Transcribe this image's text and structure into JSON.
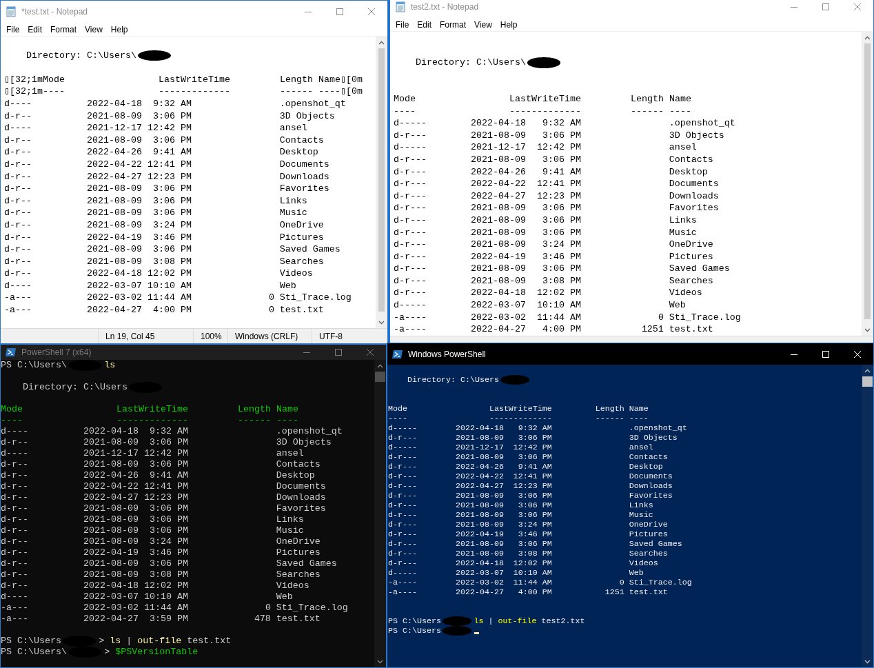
{
  "windows": [
    {
      "kind": "notepad",
      "title": "*test.txt - Notepad",
      "active": false,
      "menu": [
        "File",
        "Edit",
        "Format",
        "View",
        "Help"
      ],
      "lines": [
        {
          "kind": "blank"
        },
        {
          "kind": "directory",
          "parts": [
            {
              "kind": "plain",
              "text": "Directory: C:\\Users\\"
            },
            {
              "kind": "redacted"
            }
          ]
        },
        {
          "kind": "blank"
        },
        {
          "kind": "header",
          "cells": [
            "▯[32;1mMode",
            "LastWriteTime",
            "Length",
            "Name▯[0m"
          ]
        },
        {
          "kind": "underline",
          "cells": [
            "▯[32;1m----",
            "-------------",
            "------",
            "----▯[0m"
          ]
        },
        {
          "kind": "row",
          "mode": "d----",
          "date": "2022-04-18",
          "time": "9:32 AM",
          "name": ".openshot_qt"
        },
        {
          "kind": "row",
          "mode": "d-r--",
          "date": "2021-08-09",
          "time": "3:06 PM",
          "name": "3D Objects"
        },
        {
          "kind": "row",
          "mode": "d----",
          "date": "2021-12-17",
          "time": "12:42 PM",
          "name": "ansel"
        },
        {
          "kind": "row",
          "mode": "d-r--",
          "date": "2021-08-09",
          "time": "3:06 PM",
          "name": "Contacts"
        },
        {
          "kind": "row",
          "mode": "d-r--",
          "date": "2022-04-26",
          "time": "9:41 AM",
          "name": "Desktop"
        },
        {
          "kind": "row",
          "mode": "d-r--",
          "date": "2022-04-22",
          "time": "12:41 PM",
          "name": "Documents"
        },
        {
          "kind": "row",
          "mode": "d-r--",
          "date": "2022-04-27",
          "time": "12:23 PM",
          "name": "Downloads"
        },
        {
          "kind": "row",
          "mode": "d-r--",
          "date": "2021-08-09",
          "time": "3:06 PM",
          "name": "Favorites"
        },
        {
          "kind": "row",
          "mode": "d-r--",
          "date": "2021-08-09",
          "time": "3:06 PM",
          "name": "Links"
        },
        {
          "kind": "row",
          "mode": "d-r--",
          "date": "2021-08-09",
          "time": "3:06 PM",
          "name": "Music"
        },
        {
          "kind": "row",
          "mode": "d-r--",
          "date": "2021-08-09",
          "time": "3:24 PM",
          "name": "OneDrive"
        },
        {
          "kind": "row",
          "mode": "d-r--",
          "date": "2022-04-19",
          "time": "3:46 PM",
          "name": "Pictures"
        },
        {
          "kind": "row",
          "mode": "d-r--",
          "date": "2021-08-09",
          "time": "3:06 PM",
          "name": "Saved Games"
        },
        {
          "kind": "row",
          "mode": "d-r--",
          "date": "2021-08-09",
          "time": "3:08 PM",
          "name": "Searches"
        },
        {
          "kind": "row",
          "mode": "d-r--",
          "date": "2022-04-18",
          "time": "12:02 PM",
          "name": "Videos"
        },
        {
          "kind": "row",
          "mode": "d----",
          "date": "2022-03-07",
          "time": "10:10 AM",
          "name": "Web"
        },
        {
          "kind": "row",
          "mode": "-a---",
          "date": "2022-03-02",
          "time": "11:44 AM",
          "length": "0",
          "name": "Sti_Trace.log"
        },
        {
          "kind": "row",
          "mode": "-a---",
          "date": "2022-04-27",
          "time": "4:00 PM",
          "length": "0",
          "name": "test.txt"
        }
      ],
      "status": [
        "Ln 19, Col 45",
        "100%",
        "Windows (CRLF)",
        "UTF-8"
      ]
    },
    {
      "kind": "notepad",
      "title": "test2.txt - Notepad",
      "active": false,
      "menu": [
        "File",
        "Edit",
        "Format",
        "View",
        "Help"
      ],
      "lines": [
        {
          "kind": "blank"
        },
        {
          "kind": "blank"
        },
        {
          "kind": "directory",
          "parts": [
            {
              "kind": "plain",
              "text": "Directory: C:\\Users\\"
            },
            {
              "kind": "redacted"
            }
          ]
        },
        {
          "kind": "blank"
        },
        {
          "kind": "blank"
        },
        {
          "kind": "header",
          "cells": [
            "Mode",
            "LastWriteTime",
            "Length",
            "Name"
          ]
        },
        {
          "kind": "underline",
          "cells": [
            "----",
            "-------------",
            "------",
            "----"
          ]
        },
        {
          "kind": "row",
          "mode": "d-----",
          "date": "2022-04-18",
          "time": "9:32 AM",
          "name": ".openshot_qt"
        },
        {
          "kind": "row",
          "mode": "d-r---",
          "date": "2021-08-09",
          "time": "3:06 PM",
          "name": "3D Objects"
        },
        {
          "kind": "row",
          "mode": "d-----",
          "date": "2021-12-17",
          "time": "12:42 PM",
          "name": "ansel"
        },
        {
          "kind": "row",
          "mode": "d-r---",
          "date": "2021-08-09",
          "time": "3:06 PM",
          "name": "Contacts"
        },
        {
          "kind": "row",
          "mode": "d-r---",
          "date": "2022-04-26",
          "time": "9:41 AM",
          "name": "Desktop"
        },
        {
          "kind": "row",
          "mode": "d-r---",
          "date": "2022-04-22",
          "time": "12:41 PM",
          "name": "Documents"
        },
        {
          "kind": "row",
          "mode": "d-r---",
          "date": "2022-04-27",
          "time": "12:23 PM",
          "name": "Downloads"
        },
        {
          "kind": "row",
          "mode": "d-r---",
          "date": "2021-08-09",
          "time": "3:06 PM",
          "name": "Favorites"
        },
        {
          "kind": "row",
          "mode": "d-r---",
          "date": "2021-08-09",
          "time": "3:06 PM",
          "name": "Links"
        },
        {
          "kind": "row",
          "mode": "d-r---",
          "date": "2021-08-09",
          "time": "3:06 PM",
          "name": "Music"
        },
        {
          "kind": "row",
          "mode": "d-r---",
          "date": "2021-08-09",
          "time": "3:24 PM",
          "name": "OneDrive"
        },
        {
          "kind": "row",
          "mode": "d-r---",
          "date": "2022-04-19",
          "time": "3:46 PM",
          "name": "Pictures"
        },
        {
          "kind": "row",
          "mode": "d-r---",
          "date": "2021-08-09",
          "time": "3:06 PM",
          "name": "Saved Games"
        },
        {
          "kind": "row",
          "mode": "d-r---",
          "date": "2021-08-09",
          "time": "3:08 PM",
          "name": "Searches"
        },
        {
          "kind": "row",
          "mode": "d-r---",
          "date": "2022-04-18",
          "time": "12:02 PM",
          "name": "Videos"
        },
        {
          "kind": "row",
          "mode": "d-----",
          "date": "2022-03-07",
          "time": "10:10 AM",
          "name": "Web"
        },
        {
          "kind": "row",
          "mode": "-a----",
          "date": "2022-03-02",
          "time": "11:44 AM",
          "length": "0",
          "name": "Sti_Trace.log"
        },
        {
          "kind": "row",
          "mode": "-a----",
          "date": "2022-04-27",
          "time": "4:00 PM",
          "length": "1251",
          "name": "test.txt"
        }
      ]
    },
    {
      "kind": "pwsh",
      "title": "PowerShell 7 (x64)",
      "active": false,
      "lines": [
        {
          "kind": "prompt",
          "parts": [
            {
              "kind": "plain",
              "text": "PS C:\\Users\\"
            },
            {
              "kind": "redacted"
            },
            {
              "kind": "command",
              "text": "ls"
            }
          ]
        },
        {
          "kind": "blank"
        },
        {
          "kind": "directory",
          "parts": [
            {
              "kind": "plain",
              "text": "Directory: C:\\Users"
            },
            {
              "kind": "redacted"
            }
          ]
        },
        {
          "kind": "blank"
        },
        {
          "kind": "header",
          "cells": [
            "Mode",
            "LastWriteTime",
            "Length",
            "Name"
          ]
        },
        {
          "kind": "underline",
          "cells": [
            "----",
            "-------------",
            "------",
            "----"
          ]
        },
        {
          "kind": "row",
          "mode": "d----",
          "date": "2022-04-18",
          "time": "9:32 AM",
          "name": ".openshot_qt"
        },
        {
          "kind": "row",
          "mode": "d-r--",
          "date": "2021-08-09",
          "time": "3:06 PM",
          "name": "3D Objects"
        },
        {
          "kind": "row",
          "mode": "d----",
          "date": "2021-12-17",
          "time": "12:42 PM",
          "name": "ansel"
        },
        {
          "kind": "row",
          "mode": "d-r--",
          "date": "2021-08-09",
          "time": "3:06 PM",
          "name": "Contacts"
        },
        {
          "kind": "row",
          "mode": "d-r--",
          "date": "2022-04-26",
          "time": "9:41 AM",
          "name": "Desktop"
        },
        {
          "kind": "row",
          "mode": "d-r--",
          "date": "2022-04-22",
          "time": "12:41 PM",
          "name": "Documents"
        },
        {
          "kind": "row",
          "mode": "d-r--",
          "date": "2022-04-27",
          "time": "12:23 PM",
          "name": "Downloads"
        },
        {
          "kind": "row",
          "mode": "d-r--",
          "date": "2021-08-09",
          "time": "3:06 PM",
          "name": "Favorites"
        },
        {
          "kind": "row",
          "mode": "d-r--",
          "date": "2021-08-09",
          "time": "3:06 PM",
          "name": "Links"
        },
        {
          "kind": "row",
          "mode": "d-r--",
          "date": "2021-08-09",
          "time": "3:06 PM",
          "name": "Music"
        },
        {
          "kind": "row",
          "mode": "d-r--",
          "date": "2021-08-09",
          "time": "3:24 PM",
          "name": "OneDrive"
        },
        {
          "kind": "row",
          "mode": "d-r--",
          "date": "2022-04-19",
          "time": "3:46 PM",
          "name": "Pictures"
        },
        {
          "kind": "row",
          "mode": "d-r--",
          "date": "2021-08-09",
          "time": "3:06 PM",
          "name": "Saved Games"
        },
        {
          "kind": "row",
          "mode": "d-r--",
          "date": "2021-08-09",
          "time": "3:08 PM",
          "name": "Searches"
        },
        {
          "kind": "row",
          "mode": "d-r--",
          "date": "2022-04-18",
          "time": "12:02 PM",
          "name": "Videos"
        },
        {
          "kind": "row",
          "mode": "d----",
          "date": "2022-03-07",
          "time": "10:10 AM",
          "name": "Web"
        },
        {
          "kind": "row",
          "mode": "-a---",
          "date": "2022-03-02",
          "time": "11:44 AM",
          "length": "0",
          "name": "Sti_Trace.log"
        },
        {
          "kind": "row",
          "mode": "-a---",
          "date": "2022-04-27",
          "time": "3:59 PM",
          "length": "478",
          "name": "test.txt"
        },
        {
          "kind": "blank"
        },
        {
          "kind": "prompt",
          "parts": [
            {
              "kind": "plain",
              "text": "PS C:\\Users"
            },
            {
              "kind": "redacted"
            },
            {
              "kind": "plain",
              "text": ">"
            },
            {
              "kind": "command",
              "text": "ls"
            },
            {
              "kind": "plain",
              "text": "|"
            },
            {
              "kind": "command",
              "text": "out-file"
            },
            {
              "kind": "plain",
              "text": "test.txt"
            }
          ]
        },
        {
          "kind": "prompt",
          "parts": [
            {
              "kind": "plain",
              "text": "PS C:\\Users\\"
            },
            {
              "kind": "redacted"
            },
            {
              "kind": "plain",
              "text": ">"
            },
            {
              "kind": "variable",
              "text": "$PSVersionTable"
            }
          ]
        }
      ]
    },
    {
      "kind": "powershell",
      "title": "Windows PowerShell",
      "active": true,
      "lines": [
        {
          "kind": "blank"
        },
        {
          "kind": "directory",
          "parts": [
            {
              "kind": "plain",
              "text": "Directory: C:\\Users"
            },
            {
              "kind": "redacted"
            }
          ]
        },
        {
          "kind": "blank"
        },
        {
          "kind": "blank"
        },
        {
          "kind": "header",
          "cells": [
            "Mode",
            "LastWriteTime",
            "Length",
            "Name"
          ]
        },
        {
          "kind": "underline",
          "cells": [
            "----",
            "-------------",
            "------",
            "----"
          ]
        },
        {
          "kind": "row",
          "mode": "d-----",
          "date": "2022-04-18",
          "time": "9:32 AM",
          "name": ".openshot_qt"
        },
        {
          "kind": "row",
          "mode": "d-r---",
          "date": "2021-08-09",
          "time": "3:06 PM",
          "name": "3D Objects"
        },
        {
          "kind": "row",
          "mode": "d-----",
          "date": "2021-12-17",
          "time": "12:42 PM",
          "name": "ansel"
        },
        {
          "kind": "row",
          "mode": "d-r---",
          "date": "2021-08-09",
          "time": "3:06 PM",
          "name": "Contacts"
        },
        {
          "kind": "row",
          "mode": "d-r---",
          "date": "2022-04-26",
          "time": "9:41 AM",
          "name": "Desktop"
        },
        {
          "kind": "row",
          "mode": "d-r---",
          "date": "2022-04-22",
          "time": "12:41 PM",
          "name": "Documents"
        },
        {
          "kind": "row",
          "mode": "d-r---",
          "date": "2022-04-27",
          "time": "12:23 PM",
          "name": "Downloads"
        },
        {
          "kind": "row",
          "mode": "d-r---",
          "date": "2021-08-09",
          "time": "3:06 PM",
          "name": "Favorites"
        },
        {
          "kind": "row",
          "mode": "d-r---",
          "date": "2021-08-09",
          "time": "3:06 PM",
          "name": "Links"
        },
        {
          "kind": "row",
          "mode": "d-r---",
          "date": "2021-08-09",
          "time": "3:06 PM",
          "name": "Music"
        },
        {
          "kind": "row",
          "mode": "d-r---",
          "date": "2021-08-09",
          "time": "3:24 PM",
          "name": "OneDrive"
        },
        {
          "kind": "row",
          "mode": "d-r---",
          "date": "2022-04-19",
          "time": "3:46 PM",
          "name": "Pictures"
        },
        {
          "kind": "row",
          "mode": "d-r---",
          "date": "2021-08-09",
          "time": "3:06 PM",
          "name": "Saved Games"
        },
        {
          "kind": "row",
          "mode": "d-r---",
          "date": "2021-08-09",
          "time": "3:08 PM",
          "name": "Searches"
        },
        {
          "kind": "row",
          "mode": "d-r---",
          "date": "2022-04-18",
          "time": "12:02 PM",
          "name": "Videos"
        },
        {
          "kind": "row",
          "mode": "d-----",
          "date": "2022-03-07",
          "time": "10:10 AM",
          "name": "Web"
        },
        {
          "kind": "row",
          "mode": "-a----",
          "date": "2022-03-02",
          "time": "11:44 AM",
          "length": "0",
          "name": "Sti_Trace.log"
        },
        {
          "kind": "row",
          "mode": "-a----",
          "date": "2022-04-27",
          "time": "4:00 PM",
          "length": "1251",
          "name": "test.txt"
        },
        {
          "kind": "blank"
        },
        {
          "kind": "blank"
        },
        {
          "kind": "prompt",
          "parts": [
            {
              "kind": "plain",
              "text": "PS C:\\Users"
            },
            {
              "kind": "redacted"
            },
            {
              "kind": "command",
              "text": "ls"
            },
            {
              "kind": "plain",
              "text": "|"
            },
            {
              "kind": "command",
              "text": "out-file"
            },
            {
              "kind": "plain",
              "text": "test2.txt"
            }
          ]
        },
        {
          "kind": "prompt",
          "parts": [
            {
              "kind": "plain",
              "text": "PS C:\\Users"
            },
            {
              "kind": "redacted"
            },
            {
              "kind": "cursor"
            }
          ]
        }
      ]
    }
  ]
}
